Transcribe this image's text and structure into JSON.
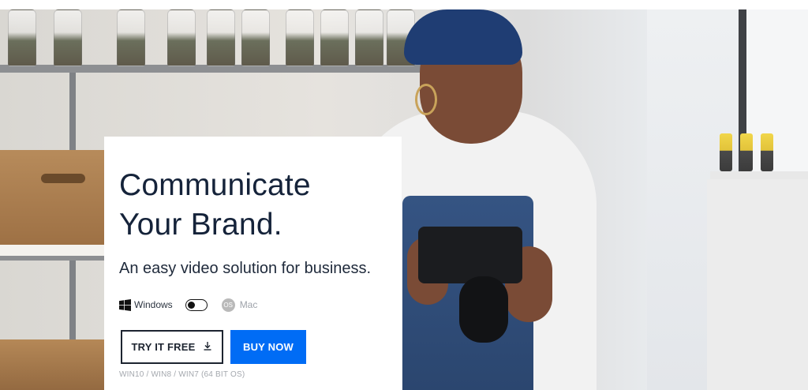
{
  "hero": {
    "headline_line1": "Communicate",
    "headline_line2": "Your Brand.",
    "subheadline": "An easy video solution for business."
  },
  "platform_toggle": {
    "left_label": "Windows",
    "right_label": "Mac",
    "selected": "Windows",
    "left_icon": "windows-icon",
    "right_icon": "mac-os-icon",
    "mac_icon_text": "OS"
  },
  "buttons": {
    "try_label": "TRY IT FREE",
    "try_icon": "download-icon",
    "buy_label": "BUY NOW"
  },
  "os_note": "WIN10 / WIN8 / WIN7 (64 BIT OS)",
  "colors": {
    "buy_button": "#006cf5",
    "headline": "#15233a"
  }
}
